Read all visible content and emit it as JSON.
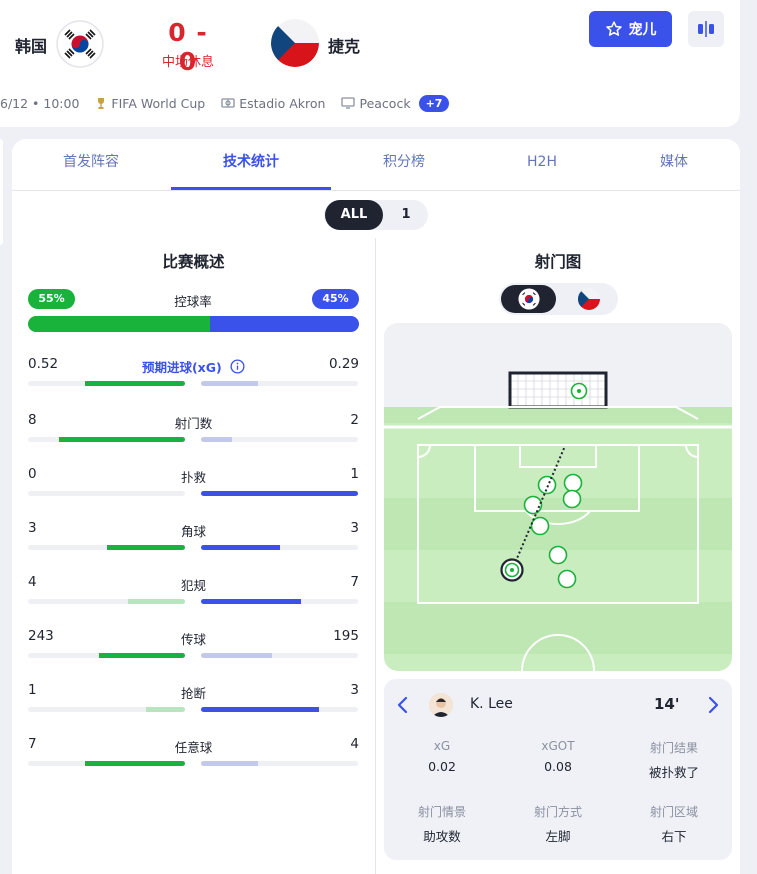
{
  "match": {
    "home": {
      "name": "韩国"
    },
    "away": {
      "name": "捷克"
    },
    "score": "0 - 0",
    "status": "中场休息",
    "favorite_label": "宠儿",
    "meta": {
      "datetime": "6/12 • 10:00",
      "competition": "FIFA World Cup",
      "venue": "Estadio Akron",
      "broadcaster": "Peacock",
      "more_badge": "+7"
    }
  },
  "tabs": [
    {
      "label": "首发阵容",
      "active": false
    },
    {
      "label": "技术统计",
      "active": true
    },
    {
      "label": "积分榜",
      "active": false
    },
    {
      "label": "H2H",
      "active": false
    },
    {
      "label": "媒体",
      "active": false
    }
  ],
  "period_toggle": {
    "all": "ALL",
    "first": "1",
    "selected": "ALL"
  },
  "overview": {
    "title": "比赛概述",
    "possession": {
      "label": "控球率",
      "home": "55%",
      "away": "45%",
      "home_value": 55,
      "away_value": 45
    },
    "stats": [
      {
        "label": "预期进球(xG)",
        "home": "0.52",
        "away": "0.29",
        "home_frac": 0.64,
        "away_frac": 0.36,
        "link": true
      },
      {
        "label": "射门数",
        "home": "8",
        "away": "2",
        "home_frac": 0.8,
        "away_frac": 0.2
      },
      {
        "label": "扑救",
        "home": "0",
        "away": "1",
        "home_frac": 0.0,
        "away_frac": 1.0
      },
      {
        "label": "角球",
        "home": "3",
        "away": "3",
        "home_frac": 0.5,
        "away_frac": 0.5
      },
      {
        "label": "犯规",
        "home": "4",
        "away": "7",
        "home_frac": 0.36,
        "away_frac": 0.64
      },
      {
        "label": "传球",
        "home": "243",
        "away": "195",
        "home_frac": 0.55,
        "away_frac": 0.45
      },
      {
        "label": "抢断",
        "home": "1",
        "away": "3",
        "home_frac": 0.25,
        "away_frac": 0.75
      },
      {
        "label": "任意球",
        "home": "7",
        "away": "4",
        "home_frac": 0.64,
        "away_frac": 0.36
      }
    ]
  },
  "shot_map": {
    "title": "射门图",
    "selected_team": "home"
  },
  "shot_detail": {
    "player": "K. Lee",
    "minute": "14'",
    "items": [
      {
        "label": "xG",
        "value": "0.02"
      },
      {
        "label": "xGOT",
        "value": "0.08"
      },
      {
        "label": "射门结果",
        "value": "被扑救了"
      },
      {
        "label": "射门情景",
        "value": "助攻数"
      },
      {
        "label": "射门方式",
        "value": "左脚"
      },
      {
        "label": "射门区域",
        "value": "右下"
      }
    ]
  },
  "colors": {
    "home": "#19b23a",
    "away": "#3a52ea",
    "home_light": "#b8e4bf",
    "away_light": "#c3c9e8",
    "accent": "#3a52ea",
    "score": "#d7262e"
  }
}
